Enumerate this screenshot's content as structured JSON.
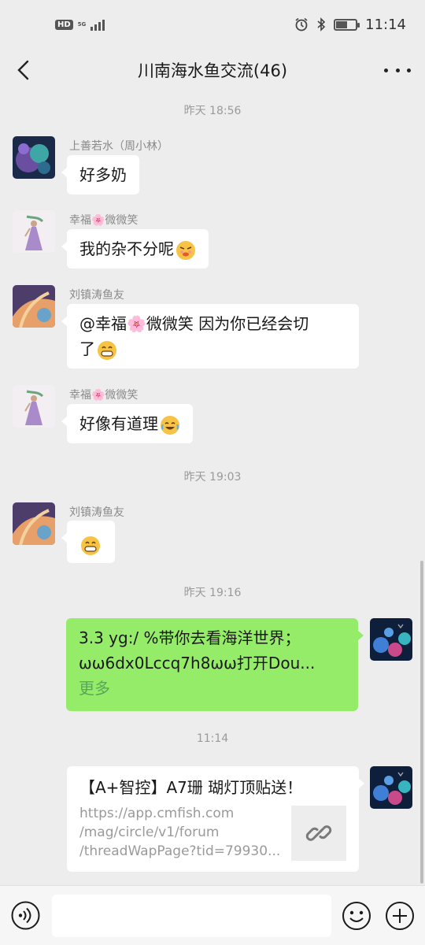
{
  "status_bar": {
    "hd": "HD",
    "network": "5G",
    "time": "11:14",
    "battery_level": 0.55
  },
  "header": {
    "title": "川南海水鱼交流(46)"
  },
  "messages": {
    "t1": "昨天 18:56",
    "m1_sender": "上善若水（周小林）",
    "m1_text": "好多奶",
    "m2_sender": "幸福🌸微微笑",
    "m2_text": "我的杂不分呢",
    "m3_sender": "刘镇涛鱼友",
    "m3_line1": "@幸福🌸微微笑  因为你已经会切",
    "m3_line2": "了",
    "m4_sender": "幸福🌸微微笑",
    "m4_text": "好像有道理",
    "t2": "昨天 19:03",
    "m5_sender": "刘镇涛鱼友",
    "t3": "昨天 19:16",
    "m6_line1": "3.3 yg:/ %带你去看海洋世界；",
    "m6_line2": "ωω6dx0Lccq7h8ωω打开Dou...",
    "m6_more": "更多",
    "t4": "11:14",
    "m7_title": "【A+智控】A7珊 瑚灯顶贴送！",
    "m7_line1": "https://app.cmfish.com",
    "m7_line2": "/mag/circle/v1/forum",
    "m7_line3": "/threadWapPage?tid=79930..."
  },
  "colors": {
    "background": "#ededed",
    "my_bubble": "#95ec69",
    "other_bubble": "#ffffff",
    "more_link": "#57a75b"
  },
  "icons": [
    "back-arrow-icon",
    "more-dots-icon",
    "voice-icon",
    "emoji-icon",
    "plus-icon",
    "link-icon",
    "alarm-icon",
    "bluetooth-icon",
    "battery-icon",
    "signal-icon"
  ]
}
